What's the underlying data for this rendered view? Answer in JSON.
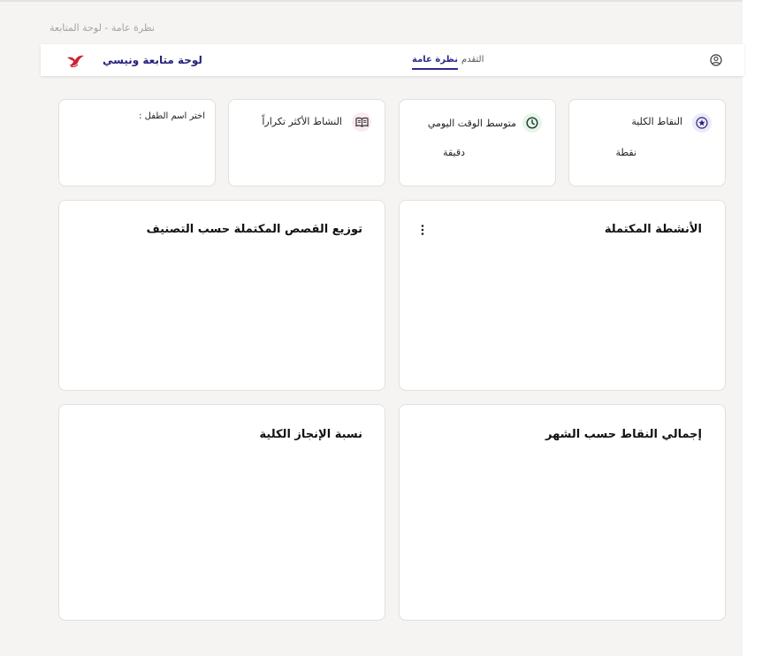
{
  "page": {
    "breadcrumb": "نظرة عامة - لوحة المتابعة"
  },
  "navbar": {
    "brand": "لوحة متابعة ونيسي",
    "tabs": [
      {
        "label": "نظرة عامة",
        "active": true
      },
      {
        "label": "التقدم",
        "active": false
      }
    ],
    "account_icon": "user-circle-icon"
  },
  "stats": {
    "total_points": {
      "title": "النقاط الكلية",
      "unit": "نقطة",
      "icon": "star-icon"
    },
    "avg_daily_time": {
      "title": "متوسط الوقت اليومي",
      "unit": "دقيقة",
      "icon": "clock-icon"
    },
    "most_frequent_activity": {
      "title": "النشاط الأكثر تكراراً",
      "icon": "book-icon"
    },
    "child_select": {
      "label": "اختر اسم الطفل :"
    }
  },
  "sections": {
    "completed_activities": {
      "title": "الأنشطة المكتملة",
      "menu_icon": "more-vertical-icon"
    },
    "stories_by_category": {
      "title": "توزيع القصص المكتملة حسب التصنيف"
    },
    "points_by_month": {
      "title": "إجمالي النقاط حسب الشهر"
    },
    "overall_completion": {
      "title": "نسبة الإنجاز الكلية"
    }
  },
  "colors": {
    "brand": "#27217b",
    "logo": "#d22030",
    "star_bg": "#eceaf8",
    "clock_bg": "#e6f5ea",
    "book_bg": "#fbeaf0"
  }
}
